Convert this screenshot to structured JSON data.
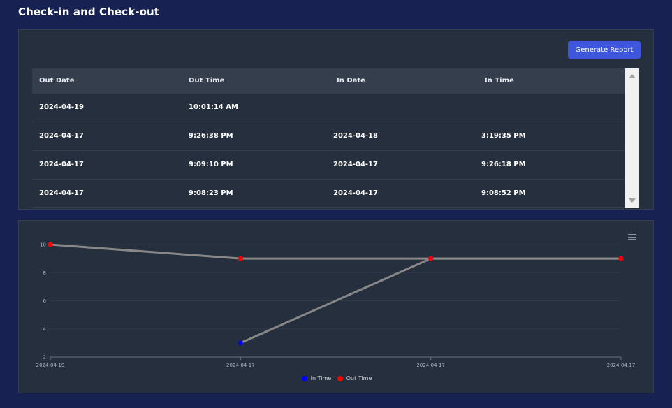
{
  "page": {
    "title": "Check-in and Check-out"
  },
  "toolbar": {
    "generate_report_label": "Generate Report"
  },
  "table": {
    "columns": [
      "Out Date",
      "Out Time",
      "In Date",
      "In Time"
    ],
    "rows": [
      [
        "2024-04-19",
        "10:01:14 AM",
        "",
        ""
      ],
      [
        "2024-04-17",
        "9:26:38 PM",
        "2024-04-18",
        "3:19:35 PM"
      ],
      [
        "2024-04-17",
        "9:09:10 PM",
        "2024-04-17",
        "9:26:18 PM"
      ],
      [
        "2024-04-17",
        "9:08:23 PM",
        "2024-04-17",
        "9:08:52 PM"
      ]
    ]
  },
  "chart_data": {
    "type": "line",
    "categories": [
      "2024-04-19",
      "2024-04-17",
      "2024-04-17",
      "2024-04-17"
    ],
    "series": [
      {
        "name": "In Time",
        "color": "#0000ff",
        "values": [
          null,
          3,
          9,
          9
        ]
      },
      {
        "name": "Out Time",
        "color": "#ff0000",
        "values": [
          10,
          9,
          9,
          9
        ]
      }
    ],
    "yticks": [
      2,
      4,
      6,
      8,
      10
    ],
    "ylim": [
      2,
      10
    ],
    "line_color": "#888888",
    "grid": true,
    "legend": "bottom-center"
  }
}
